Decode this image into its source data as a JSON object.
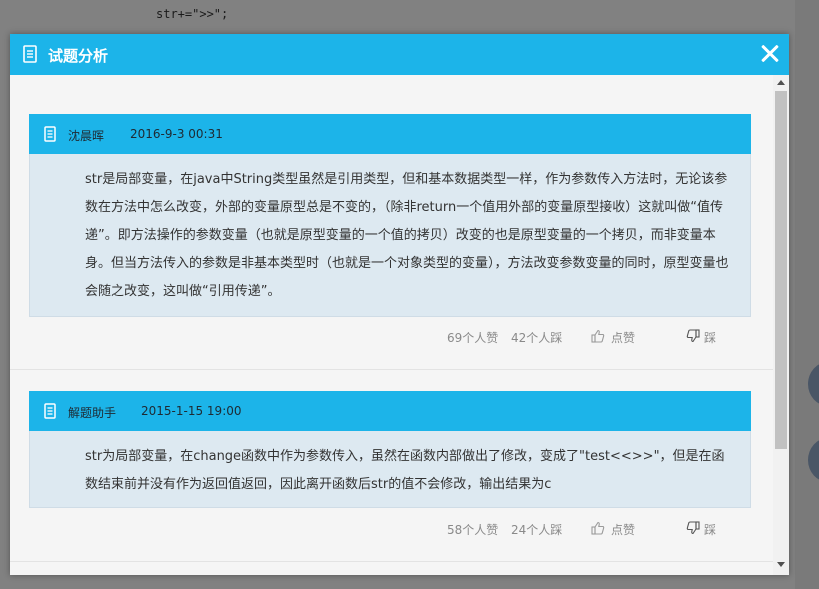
{
  "background": {
    "code_line": "str+=\">>\";"
  },
  "modal": {
    "title": "试题分析",
    "close_label": "×",
    "header_color": "#1cb4e9",
    "icon": "document-icon"
  },
  "comments": [
    {
      "author": "沈晨晖",
      "time": "2016-9-3 00:31",
      "text": "str是局部变量，在java中String类型虽然是引用类型，但和基本数据类型一样，作为参数传入方法时，无论该参数在方法中怎么改变，外部的变量原型总是不变的，（除非return一个值用外部的变量原型接收）这就叫做“值传递”。即方法操作的参数变量（也就是原型变量的一个值的拷贝）改变的也是原型变量的一个拷贝，而非变量本身。但当方法传入的参数是非基本类型时（也就是一个对象类型的变量），方法改变参数变量的同时，原型变量也会随之改变，这叫做“引用传递”。",
      "likes": "69个人赞",
      "dislikes": "42个人踩",
      "like_label": "点赞",
      "dislike_label": "踩"
    },
    {
      "author": "解题助手",
      "time": "2015-1-15 19:00",
      "text": "str为局部变量，在change函数中作为参数传入，虽然在函数内部做出了修改，变成了\"test<<>>\"，但是在函数结束前并没有作为返回值返回，因此离开函数后str的值不会修改，输出结果为c",
      "likes": "58个人赞",
      "dislikes": "24个人踩",
      "like_label": "点赞",
      "dislike_label": "踩"
    }
  ]
}
